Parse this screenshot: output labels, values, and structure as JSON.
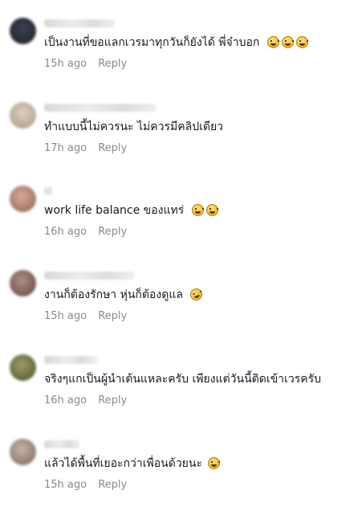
{
  "comments": [
    {
      "text": "เป็นงานที่ขอแลกเวรมาทุกวันก็ยังได้ พี่จ๋าบอก",
      "emojis": [
        "grinning-squint-icon",
        "grinning-squint-icon",
        "grinning-squint-icon"
      ],
      "time": "15h ago",
      "reply": "Reply",
      "avatar_color": "#2a2e3a"
    },
    {
      "text": "ทำแบบนี้ไม่ควรนะ ไม่ควรมีคลิปเดียว",
      "emojis": [],
      "time": "17h ago",
      "reply": "Reply",
      "avatar_color": "#c9b8a4"
    },
    {
      "text": "work life balance ของแทร่",
      "emojis": [
        "beaming-grin-icon",
        "beaming-grin-icon"
      ],
      "time": "16h ago",
      "reply": "Reply",
      "avatar_color": "#b98a7c"
    },
    {
      "text": "งานก็ต้องรักษา หุ่นก็ต้องดูแล",
      "emojis": [
        "rolling-laughing-icon"
      ],
      "time": "15h ago",
      "reply": "Reply",
      "avatar_color": "#8a6a5c"
    },
    {
      "text": "จริงๆแกเป็นผู้นำเต้นแหละครับ เพียงแต่วันนี้ติดเข้าเวรครับ",
      "emojis": [],
      "time": "16h ago",
      "reply": "Reply",
      "avatar_color": "#7a7a4a"
    },
    {
      "text": "แล้วได้พื้นที่เยอะกว่าเพื่อนด้วยนะ",
      "emojis": [
        "tears-of-joy-icon"
      ],
      "time": "15h ago",
      "reply": "Reply",
      "avatar_color": "#a89488"
    }
  ]
}
